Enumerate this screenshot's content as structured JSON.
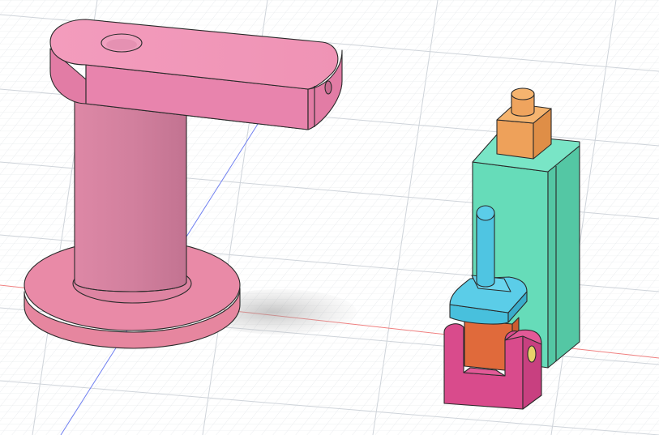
{
  "viewport": {
    "background": "#ffffff",
    "grid_color": "#d9dde2",
    "axis_colors": {
      "x": "#f08080",
      "z": "#6f7ff0"
    }
  },
  "models": [
    {
      "name": "pink-arm-stand",
      "color": "#e98aae"
    },
    {
      "name": "green-block",
      "color": "#5cd9b5"
    },
    {
      "name": "orange-cap",
      "color": "#f0a35c"
    },
    {
      "name": "blue-plunger",
      "color": "#4cc3df"
    },
    {
      "name": "orange-body",
      "color": "#e26c3f"
    },
    {
      "name": "magenta-clevis",
      "color": "#dd4b8f"
    }
  ]
}
